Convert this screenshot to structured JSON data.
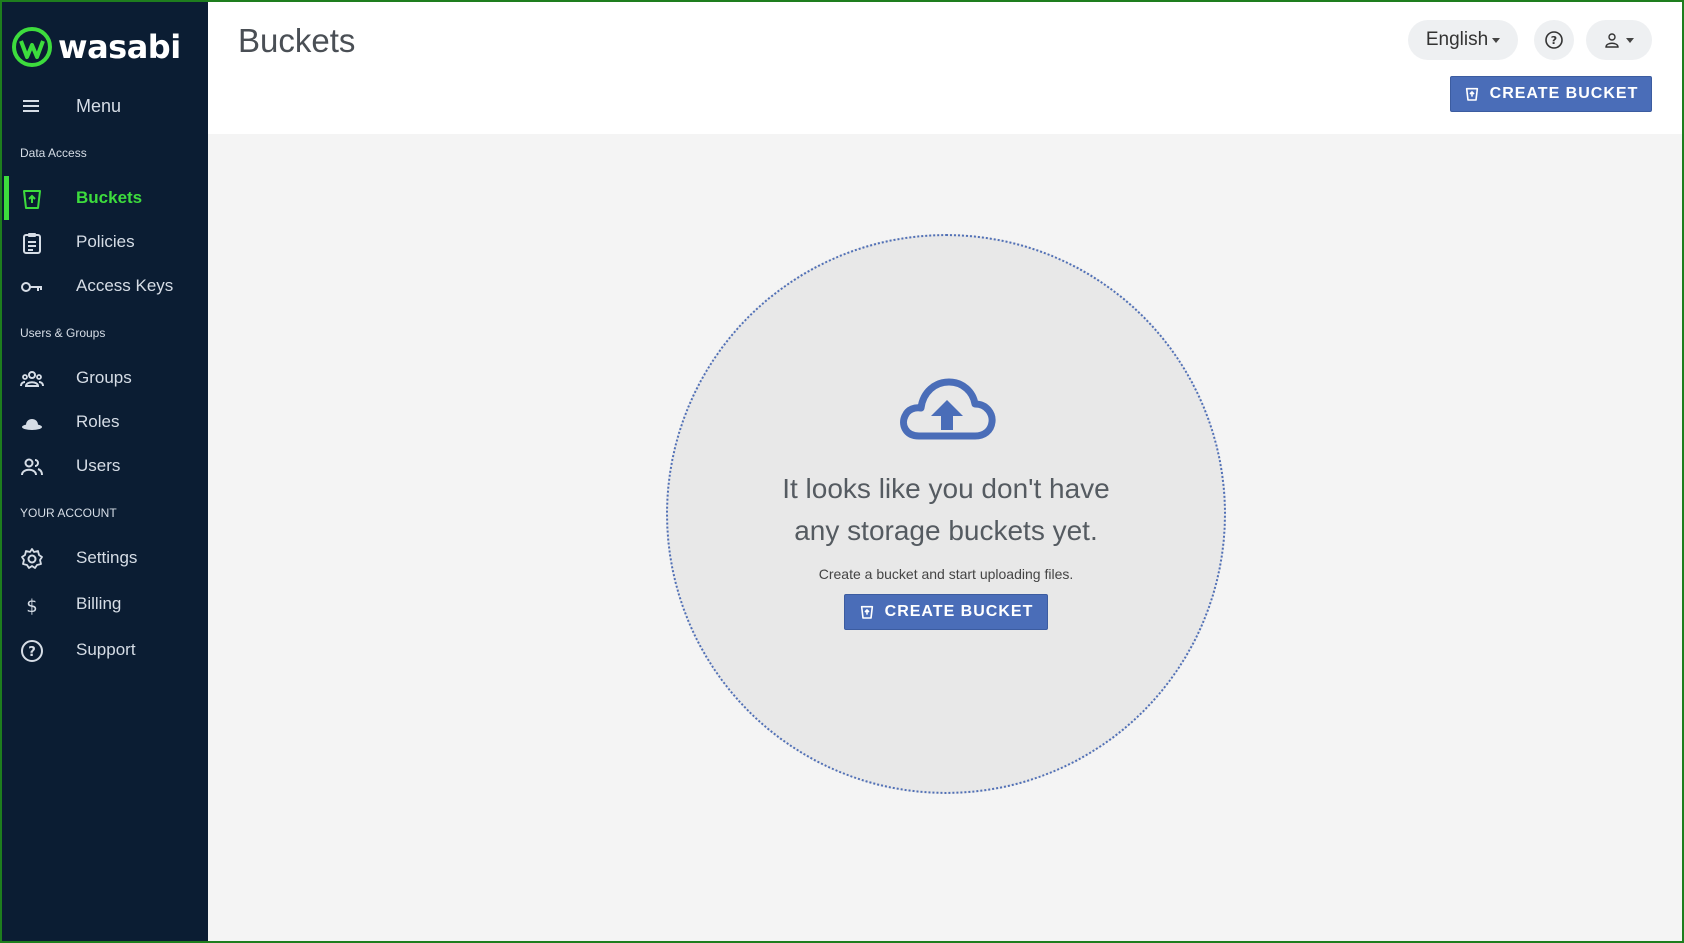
{
  "brand": {
    "name": "wasabi",
    "accent": "#3ddc3d",
    "sidebar_bg": "#0b1d33",
    "primary": "#4a6db8"
  },
  "sidebar": {
    "menu_label": "Menu",
    "sections": [
      {
        "title": "Data Access"
      },
      {
        "title": "Users & Groups"
      },
      {
        "title": "YOUR ACCOUNT"
      }
    ],
    "items": [
      {
        "label": "Buckets",
        "icon": "bucket-icon",
        "active": true
      },
      {
        "label": "Policies",
        "icon": "clipboard-icon"
      },
      {
        "label": "Access Keys",
        "icon": "key-icon"
      },
      {
        "label": "Groups",
        "icon": "groups-icon"
      },
      {
        "label": "Roles",
        "icon": "hat-icon"
      },
      {
        "label": "Users",
        "icon": "users-icon"
      },
      {
        "label": "Settings",
        "icon": "gear-icon"
      },
      {
        "label": "Billing",
        "icon": "dollar-icon"
      },
      {
        "label": "Support",
        "icon": "help-icon"
      }
    ]
  },
  "header": {
    "title": "Buckets",
    "language": "English",
    "create_button": "CREATE BUCKET"
  },
  "empty_state": {
    "title_line1": "It looks like you don't have",
    "title_line2": "any storage buckets yet.",
    "subtitle": "Create a bucket and start uploading files.",
    "button": "CREATE BUCKET"
  }
}
